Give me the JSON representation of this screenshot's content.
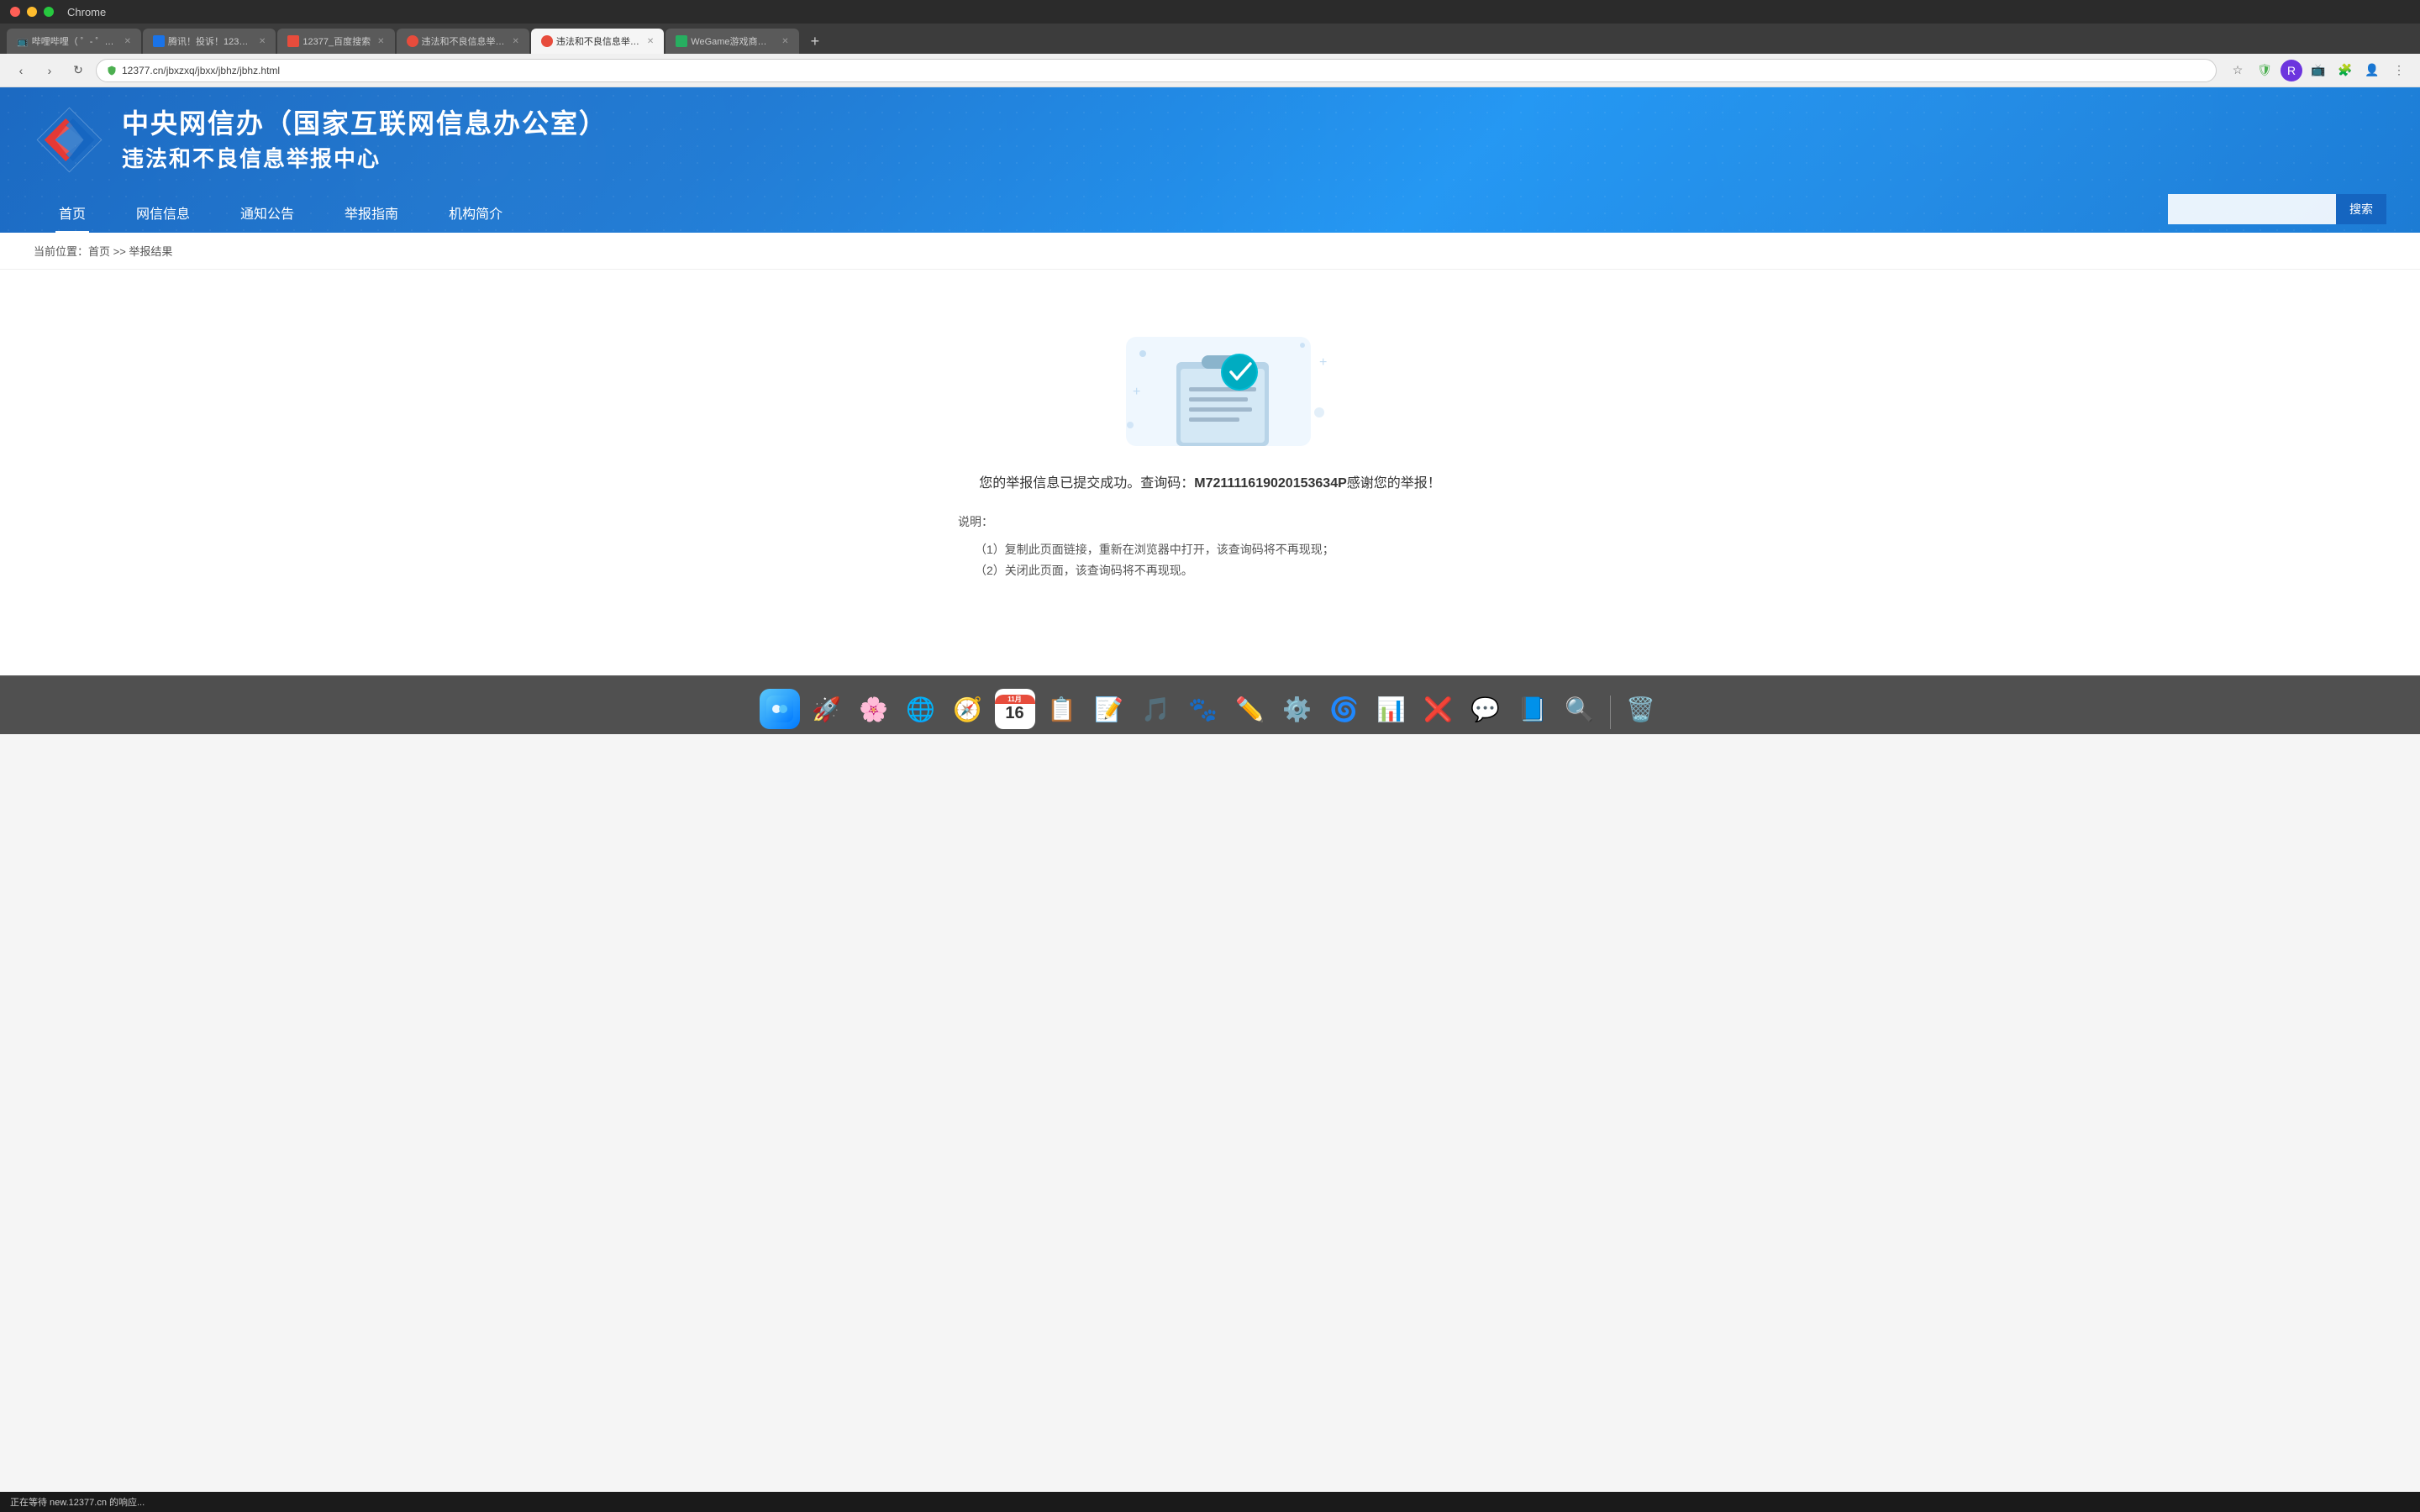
{
  "browser": {
    "title": "Chrome",
    "tabs": [
      {
        "label": "哔哩哔哩（ ゜- ゜）つロ 干...",
        "active": false,
        "favicon": "📺"
      },
      {
        "label": "腾讯！投诉！12377！_...",
        "active": false,
        "favicon": "🟦"
      },
      {
        "label": "12377_百度搜索",
        "active": false,
        "favicon": "🔵"
      },
      {
        "label": "违法和不良信息举报中心",
        "active": false,
        "favicon": "🔴"
      },
      {
        "label": "违法和不良信息举报中心",
        "active": true,
        "favicon": "🔴"
      },
      {
        "label": "WeGame游戏商店 - 发现...",
        "active": false,
        "favicon": "🟢"
      }
    ],
    "address": "12377.cn/jbxzxq/jbxx/jbhz/jbhz.html"
  },
  "site": {
    "header_title_main": "中央网信办（国家互联网信息办公室）",
    "header_title_sub": "违法和不良信息举报中心",
    "nav": {
      "items": [
        {
          "label": "首页",
          "active": true
        },
        {
          "label": "网信信息",
          "active": false
        },
        {
          "label": "通知公告",
          "active": false
        },
        {
          "label": "举报指南",
          "active": false
        },
        {
          "label": "机构简介",
          "active": false
        }
      ],
      "search_placeholder": "",
      "search_btn": "搜索"
    }
  },
  "breadcrumb": {
    "text": "当前位置：首页 >> 举报结果"
  },
  "result": {
    "success_message": "您的举报信息已提交成功。查询码：",
    "query_code": "M721111619020153634P",
    "thanks": "感谢您的举报！",
    "notice_title": "说明：",
    "notice_items": [
      "（1）复制此页面链接，重新在浏览器中打开，该查询码将不再现现；",
      "（2）关闭此页面，该查询码将不再现现。"
    ]
  },
  "status_bar": {
    "text": "正在等待 new.12377.cn 的响应..."
  },
  "dock": {
    "apps": [
      {
        "name": "Finder",
        "emoji": "🔵"
      },
      {
        "name": "Launchpad",
        "emoji": "🚀"
      },
      {
        "name": "Photos",
        "emoji": "🖼️"
      },
      {
        "name": "Chrome",
        "emoji": "🌐"
      },
      {
        "name": "Safari",
        "emoji": "🧭"
      },
      {
        "name": "Reminders",
        "emoji": "📋"
      },
      {
        "name": "Notes",
        "emoji": "📝"
      },
      {
        "name": "Music",
        "emoji": "🎵"
      },
      {
        "name": "Paw",
        "emoji": "🐾"
      },
      {
        "name": "Vectorize",
        "emoji": "✏️"
      },
      {
        "name": "Preferences",
        "emoji": "⚙️"
      },
      {
        "name": "Edge",
        "emoji": "🌀"
      },
      {
        "name": "Excel",
        "emoji": "📊"
      },
      {
        "name": "AppX",
        "emoji": "❌"
      },
      {
        "name": "Messages",
        "emoji": "💬"
      },
      {
        "name": "Word",
        "emoji": "📘"
      },
      {
        "name": "Magnifier",
        "emoji": "🔍"
      },
      {
        "name": "Trash",
        "emoji": "🗑️"
      }
    ]
  }
}
